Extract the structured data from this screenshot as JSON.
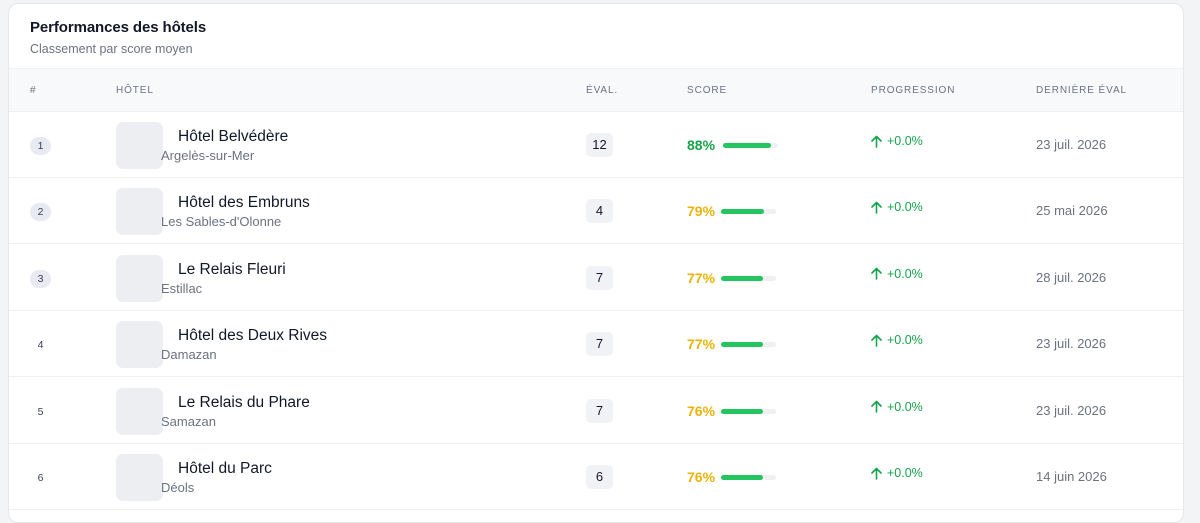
{
  "header": {
    "title": "Performances des hôtels",
    "subtitle": "Classement par score moyen"
  },
  "columns": {
    "rank": "#",
    "hotel": "Hôtel",
    "evals": "Éval.",
    "score": "Score",
    "progression": "Progression",
    "last_eval": "Dernière éval"
  },
  "colors": {
    "score_high": "#16a34a",
    "score_mid": "#eab308",
    "bar": "#22c55e",
    "progression": "#16a34a"
  },
  "rows": [
    {
      "rank": "1",
      "rank_badge": true,
      "name": "Hôtel Belvédère",
      "city": "Argelès-sur-Mer",
      "evals": "12",
      "score": "88%",
      "score_value": 88,
      "score_level": "high",
      "progression": "+0.0%",
      "progression_icon": "arrow-up-icon",
      "last_eval": "23 juil. 2026"
    },
    {
      "rank": "2",
      "rank_badge": true,
      "name": "Hôtel des Embruns",
      "city": "Les Sables-d'Olonne",
      "evals": "4",
      "score": "79%",
      "score_value": 79,
      "score_level": "mid",
      "progression": "+0.0%",
      "progression_icon": "arrow-up-icon",
      "last_eval": "25 mai 2026"
    },
    {
      "rank": "3",
      "rank_badge": true,
      "name": "Le Relais Fleuri",
      "city": "Estillac",
      "evals": "7",
      "score": "77%",
      "score_value": 77,
      "score_level": "mid",
      "progression": "+0.0%",
      "progression_icon": "arrow-up-icon",
      "last_eval": "28 juil. 2026"
    },
    {
      "rank": "4",
      "rank_badge": false,
      "name": "Hôtel des Deux Rives",
      "city": "Damazan",
      "evals": "7",
      "score": "77%",
      "score_value": 77,
      "score_level": "mid",
      "progression": "+0.0%",
      "progression_icon": "arrow-up-icon",
      "last_eval": "23 juil. 2026"
    },
    {
      "rank": "5",
      "rank_badge": false,
      "name": "Le Relais du Phare",
      "city": "Samazan",
      "evals": "7",
      "score": "76%",
      "score_value": 76,
      "score_level": "mid",
      "progression": "+0.0%",
      "progression_icon": "arrow-up-icon",
      "last_eval": "23 juil. 2026"
    },
    {
      "rank": "6",
      "rank_badge": false,
      "name": "Hôtel du Parc",
      "city": "Déols",
      "evals": "6",
      "score": "76%",
      "score_value": 76,
      "score_level": "mid",
      "progression": "+0.0%",
      "progression_icon": "arrow-up-icon",
      "last_eval": "14 juin 2026"
    }
  ]
}
